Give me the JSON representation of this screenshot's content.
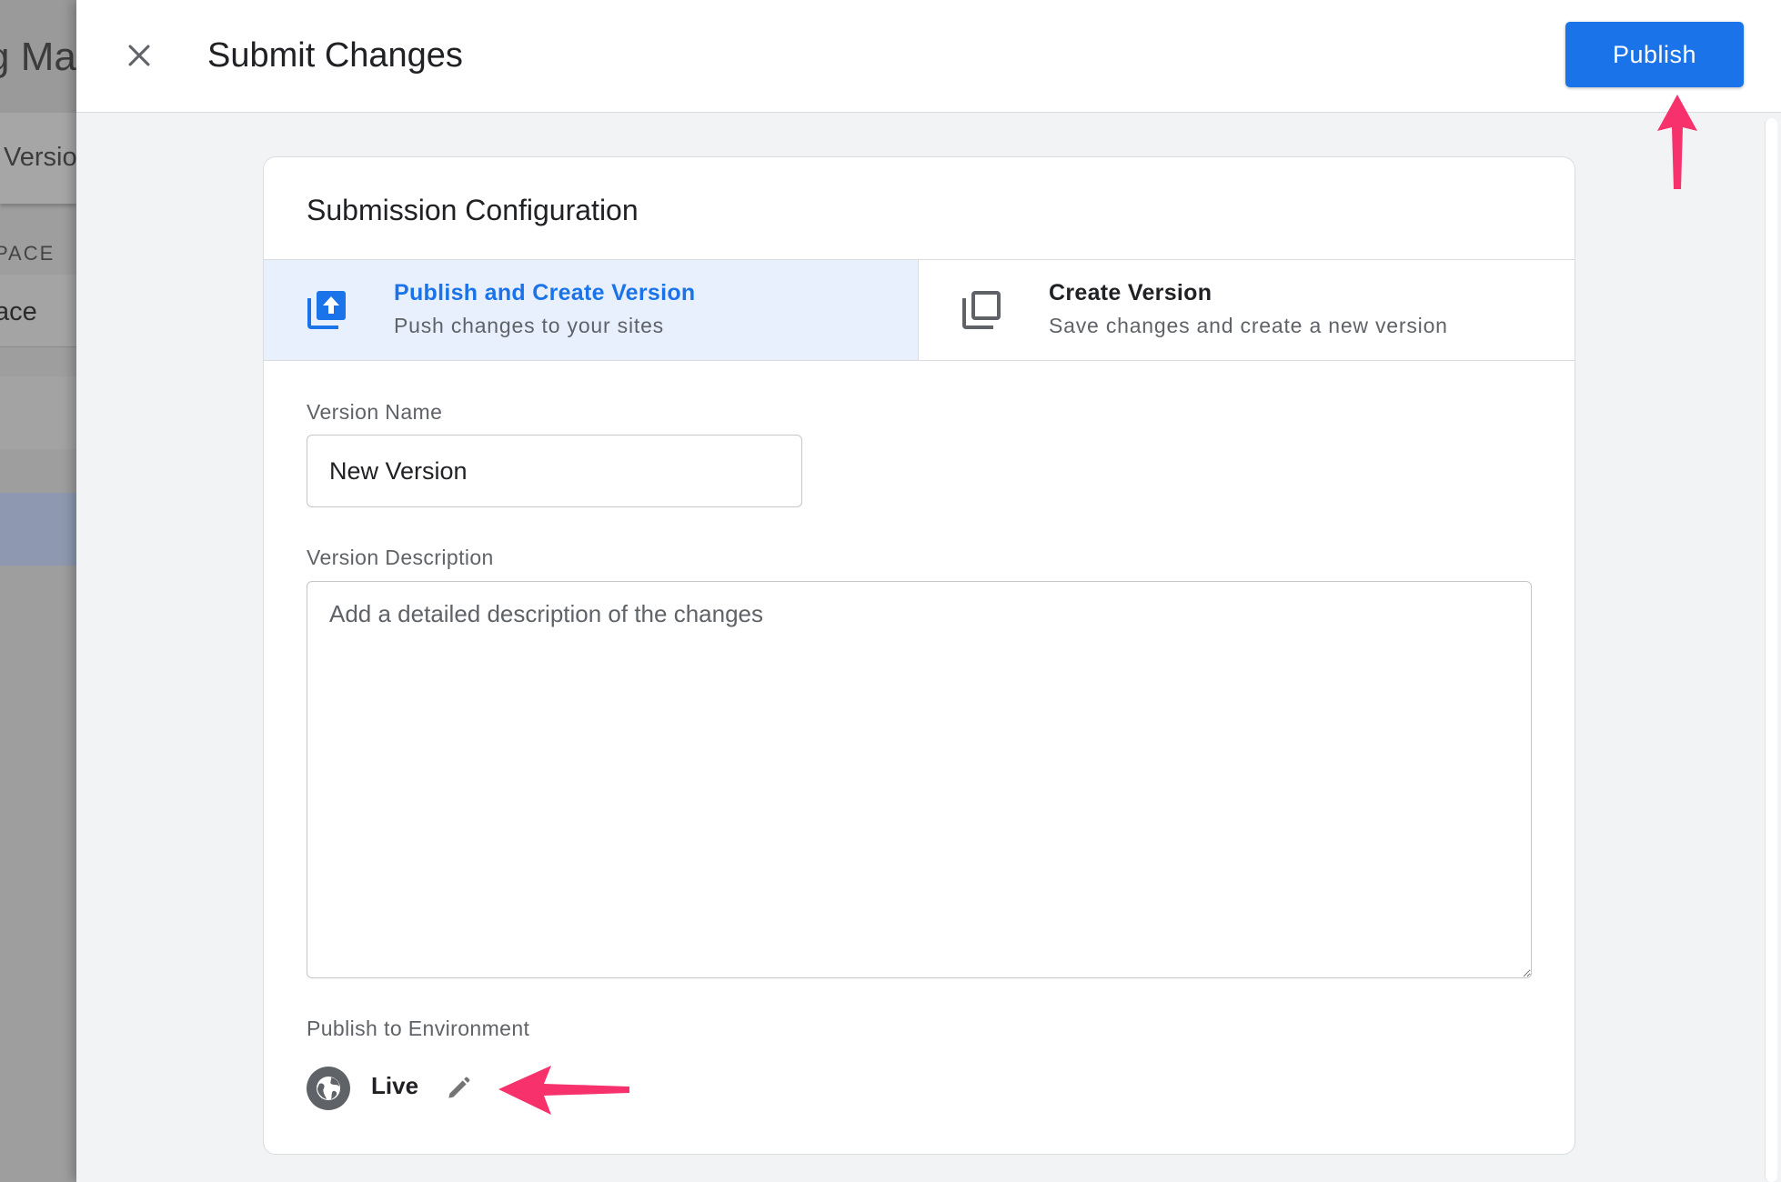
{
  "background_app": {
    "title_fragment": "g Mar",
    "versions_fragment": "Versio",
    "workspace_label_fragment": "PACE",
    "workspace_fragment": "ace"
  },
  "header": {
    "title": "Submit Changes",
    "publish_label": "Publish"
  },
  "card": {
    "title": "Submission Configuration",
    "options": [
      {
        "title": "Publish and Create Version",
        "subtitle": "Push changes to your sites",
        "icon": "publish-version-icon",
        "selected": true
      },
      {
        "title": "Create Version",
        "subtitle": "Save changes and create a new version",
        "icon": "create-version-icon",
        "selected": false
      }
    ],
    "version_name": {
      "label": "Version Name",
      "value": "New Version"
    },
    "version_description": {
      "label": "Version Description",
      "placeholder": "Add a detailed description of the changes",
      "value": ""
    },
    "environment": {
      "label": "Publish to Environment",
      "name": "Live",
      "icon": "globe-icon"
    }
  },
  "colors": {
    "accent": "#1a73e8",
    "selected_option_bg": "#e8f0fe",
    "annotation_arrow": "#f7316b"
  }
}
